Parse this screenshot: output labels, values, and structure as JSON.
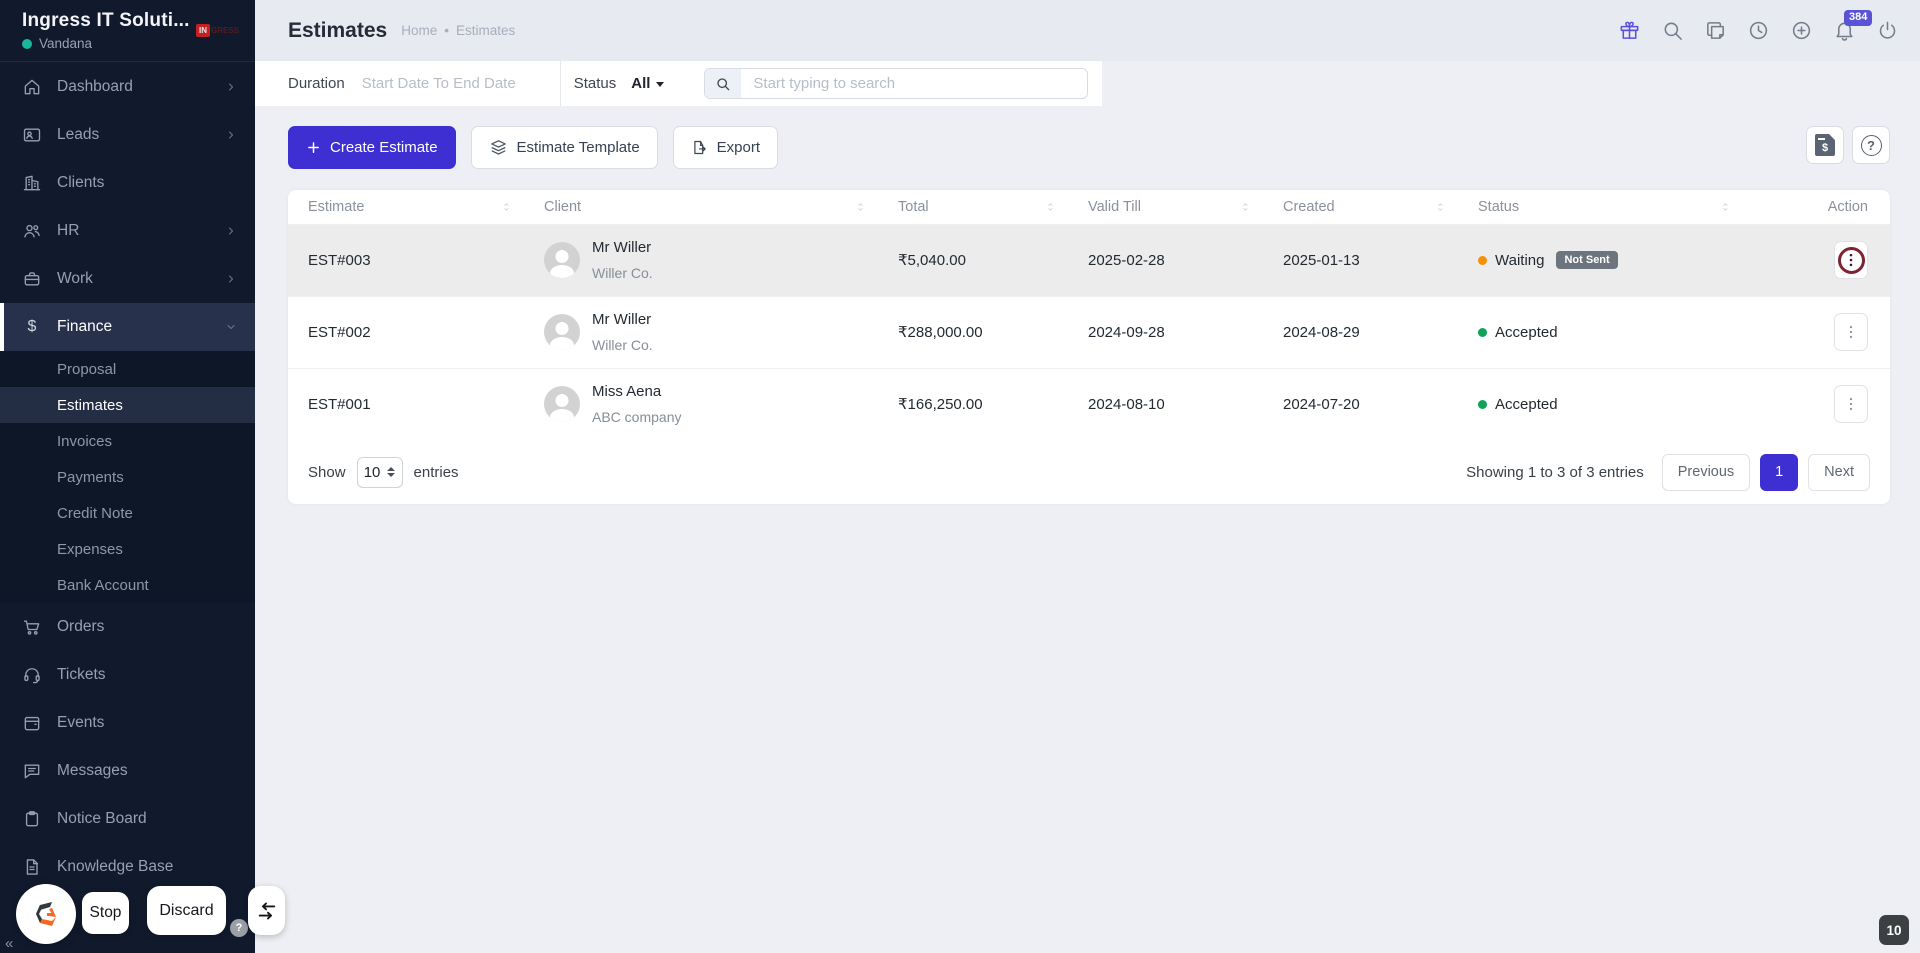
{
  "workspace": {
    "name": "Ingress IT Soluti...",
    "user": "Vandana",
    "logo_left": "IN",
    "logo_right": "GRESS"
  },
  "sidebar": {
    "items": [
      {
        "label": "Dashboard"
      },
      {
        "label": "Leads"
      },
      {
        "label": "Clients"
      },
      {
        "label": "HR"
      },
      {
        "label": "Work"
      },
      {
        "label": "Finance"
      },
      {
        "label": "Orders"
      },
      {
        "label": "Tickets"
      },
      {
        "label": "Events"
      },
      {
        "label": "Messages"
      },
      {
        "label": "Notice Board"
      },
      {
        "label": "Knowledge Base"
      }
    ],
    "finance_children": [
      {
        "label": "Proposal"
      },
      {
        "label": "Estimates",
        "active": true
      },
      {
        "label": "Invoices"
      },
      {
        "label": "Payments"
      },
      {
        "label": "Credit Note"
      },
      {
        "label": "Expenses"
      },
      {
        "label": "Bank Account"
      }
    ]
  },
  "header": {
    "title": "Estimates",
    "breadcrumb_home": "Home",
    "breadcrumb_sep": "•",
    "breadcrumb_current": "Estimates",
    "notification_count": "384"
  },
  "filters": {
    "duration_label": "Duration",
    "duration_placeholder": "Start Date To End Date",
    "status_label": "Status",
    "status_value": "All",
    "search_placeholder": "Start typing to search"
  },
  "toolbar": {
    "create_label": "Create Estimate",
    "template_label": "Estimate Template",
    "export_label": "Export"
  },
  "table": {
    "headers": [
      "Estimate",
      "Client",
      "Total",
      "Valid Till",
      "Created",
      "Status",
      "Action"
    ],
    "rows": [
      {
        "estimate": "EST#003",
        "name": "Mr Willer",
        "company": "Willer Co.",
        "total": "₹5,040.00",
        "valid_till": "2025-02-28",
        "created": "2025-01-13",
        "status": "Waiting",
        "badge": "Not Sent"
      },
      {
        "estimate": "EST#002",
        "name": "Mr Willer",
        "company": "Willer Co.",
        "total": "₹288,000.00",
        "valid_till": "2024-09-28",
        "created": "2024-08-29",
        "status": "Accepted",
        "badge": ""
      },
      {
        "estimate": "EST#001",
        "name": "Miss Aena",
        "company": "ABC company",
        "total": "₹166,250.00",
        "valid_till": "2024-08-10",
        "created": "2024-07-20",
        "status": "Accepted",
        "badge": ""
      }
    ]
  },
  "pagination": {
    "show_label": "Show",
    "page_size": "10",
    "entries_label": "entries",
    "summary": "Showing 1 to 3 of 3 entries",
    "previous_label": "Previous",
    "page": "1",
    "next_label": "Next"
  },
  "overlay": {
    "stop_label": "Stop",
    "discard_label": "Discard",
    "help_glyph": "?",
    "collapse_glyph": "«",
    "page_badge": "10"
  },
  "glyphs": {
    "dollar": "$",
    "invoice_dollar": "$",
    "help": "?"
  },
  "colors": {
    "primary": "#3d2fd1",
    "sidebar_bg": "#111a2d",
    "status_waiting": "#f79009",
    "status_accepted": "#0fa358",
    "not_sent_badge": "#6c757d",
    "action_ring": "#7c2430",
    "notification_badge": "#5a53d7"
  }
}
